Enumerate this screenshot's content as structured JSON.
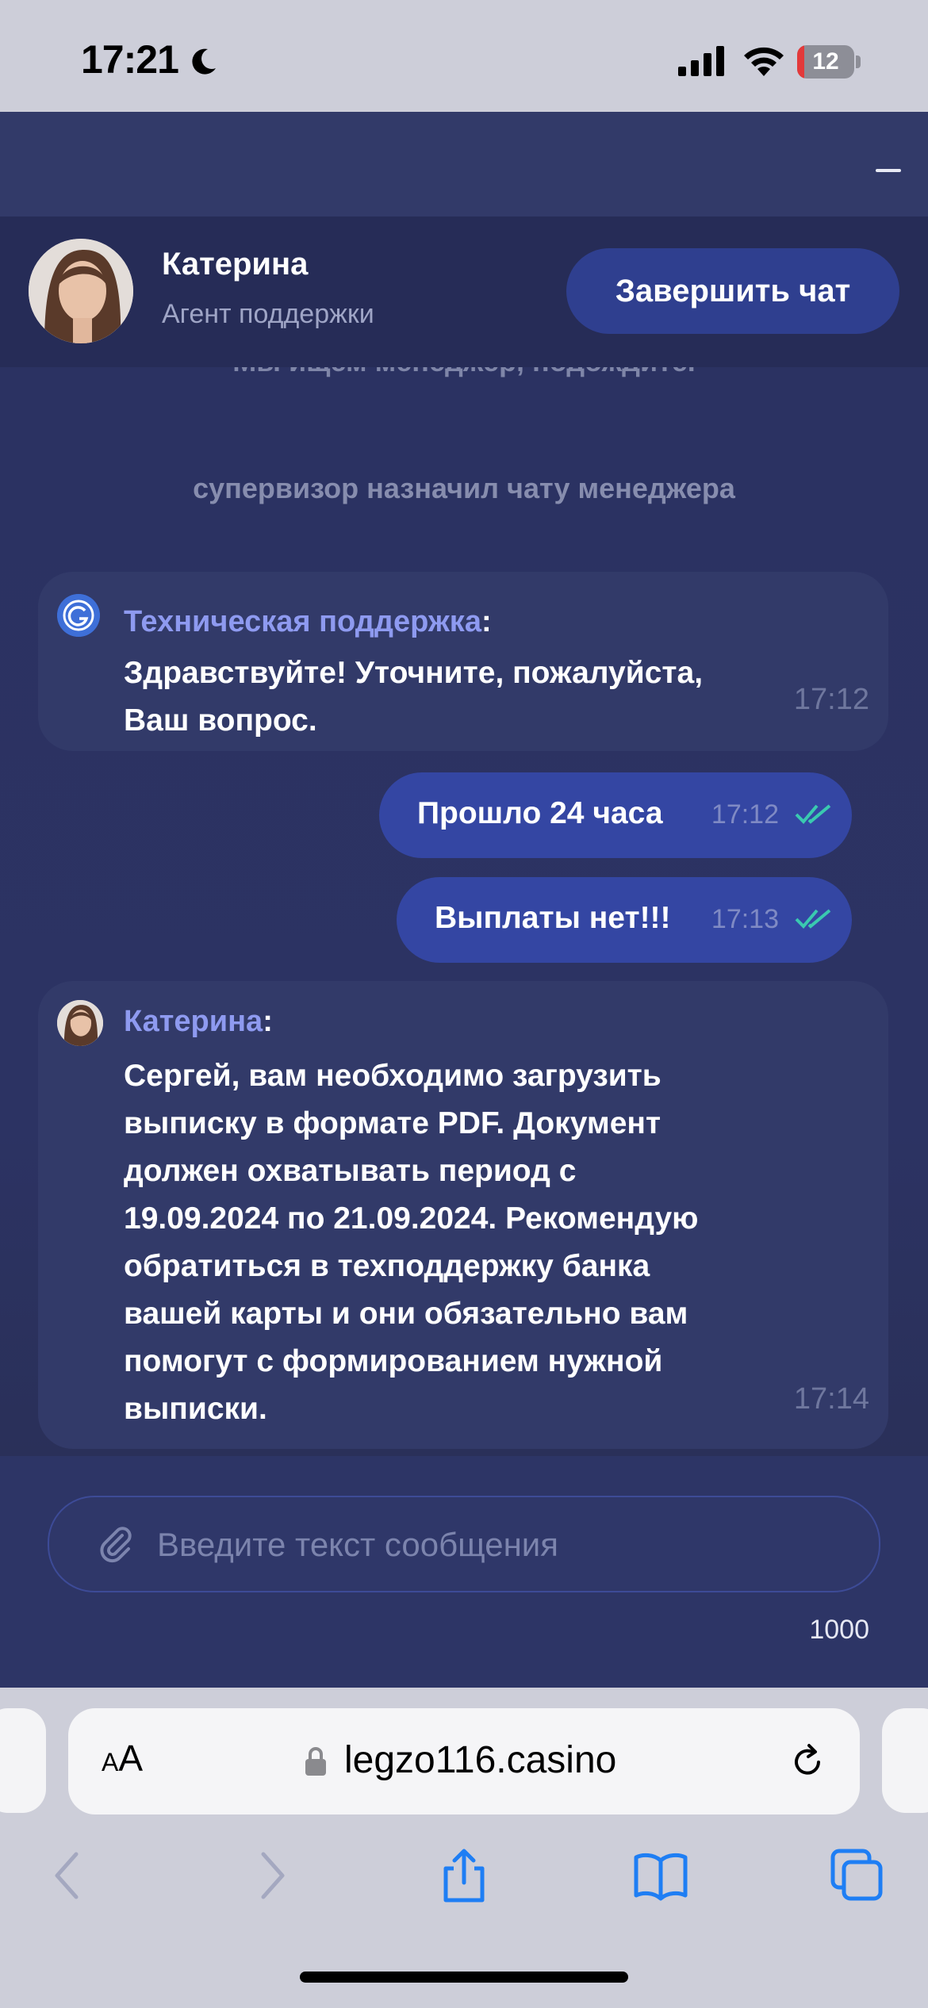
{
  "status_bar": {
    "time": "17:21",
    "battery": "12"
  },
  "chat": {
    "agent": {
      "name": "Катерина",
      "role": "Агент поддержки"
    },
    "end_chat_label": "Завершить чат",
    "system_messages": [
      "Мы ищем менеджер, подождите.",
      "супервизор назначил чату менеджера"
    ],
    "messages": [
      {
        "sender": "Техническая поддержка",
        "text_lines": [
          "Здравствуйте! Уточните, пожалуйста,",
          "Ваш вопрос."
        ],
        "time": "17:12"
      },
      {
        "text": "Прошло 24 часа",
        "time": "17:12"
      },
      {
        "text": "Выплаты нет!!!",
        "time": "17:13"
      },
      {
        "sender": "Катерина",
        "text_lines": [
          "Сергей, вам необходимо загрузить",
          "выписку в формате PDF. Документ",
          "должен охватывать период с",
          "19.09.2024 по 21.09.2024. Рекомендую",
          "обратиться в техподдержку банка",
          "вашей карты и они обязательно вам",
          "помогут с формированием нужной",
          "выписки."
        ],
        "time": "17:14"
      }
    ],
    "input": {
      "placeholder": "Введите текст сообщения",
      "value": ""
    },
    "char_limit": "1000"
  },
  "browser": {
    "aa_small": "A",
    "aa_large": "A",
    "url": "legzo116.casino"
  },
  "colors": {
    "accent": "#3446a3",
    "sender": "#8e9af0",
    "read_check": "#3ac9b0"
  }
}
